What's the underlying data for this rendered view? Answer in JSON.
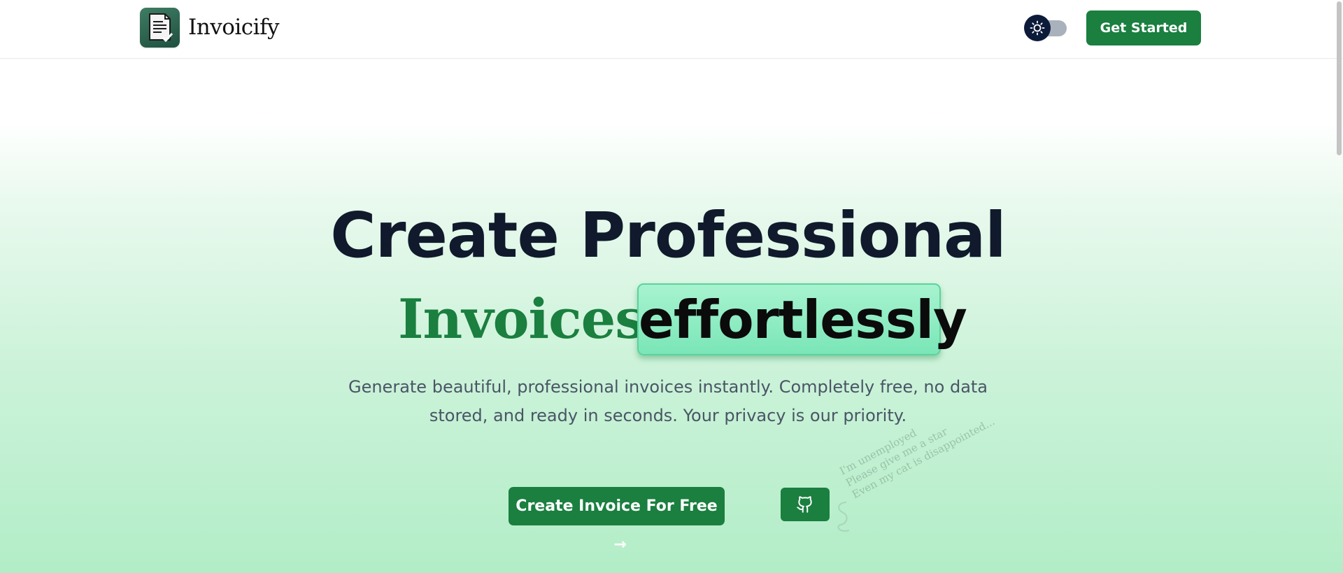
{
  "header": {
    "brand": "Invoicify",
    "get_started_label": "Get Started",
    "theme_toggle_icon": "sun-icon"
  },
  "hero": {
    "headline_line1": "Create Professional",
    "headline_word": "Invoices",
    "headline_highlight": "effortlessly",
    "subtitle": "Generate beautiful, professional invoices instantly. Completely free, no data stored, and ready in seconds. Your privacy is our priority.",
    "cta_label": "Create Invoice For Free",
    "cta_icon": "arrow-right-icon",
    "github_icon": "github-icon",
    "note_lines": [
      "I'm unemployed",
      "Please give me a star",
      "Even my cat is disappointed..."
    ]
  },
  "colors": {
    "accent": "#1a7f3f",
    "headline": "#101a2c",
    "highlight_bg": "#8eecc2",
    "toggle_knob": "#0d1b3a"
  }
}
